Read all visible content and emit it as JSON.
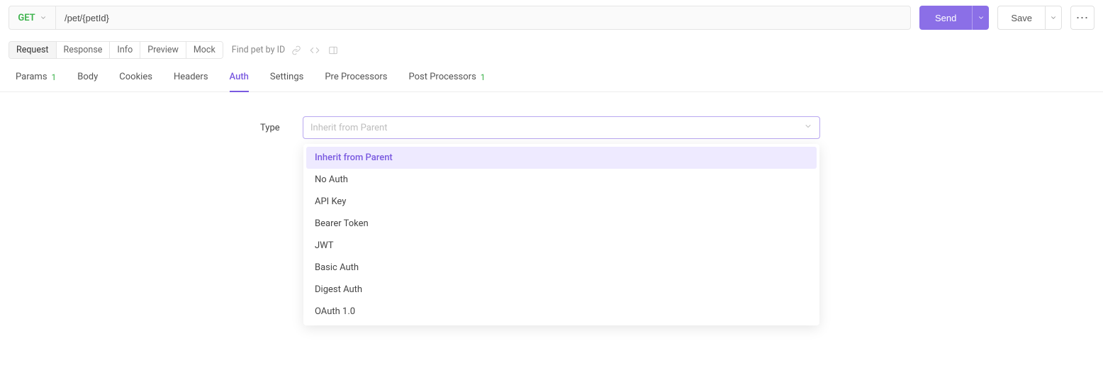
{
  "request": {
    "method": "GET",
    "url": "/pet/{petId}",
    "operation_name": "Find pet by ID"
  },
  "actions": {
    "send": "Send",
    "save": "Save"
  },
  "view_tabs": {
    "request": "Request",
    "response": "Response",
    "info": "Info",
    "preview": "Preview",
    "mock": "Mock",
    "active": "Request"
  },
  "config_tabs": {
    "items": [
      {
        "key": "params",
        "label": "Params",
        "count": "1"
      },
      {
        "key": "body",
        "label": "Body"
      },
      {
        "key": "cookies",
        "label": "Cookies"
      },
      {
        "key": "headers",
        "label": "Headers"
      },
      {
        "key": "auth",
        "label": "Auth"
      },
      {
        "key": "settings",
        "label": "Settings"
      },
      {
        "key": "pre",
        "label": "Pre Processors"
      },
      {
        "key": "post",
        "label": "Post Processors",
        "count": "1"
      }
    ],
    "active": "auth"
  },
  "auth": {
    "type_label": "Type",
    "select_placeholder": "Inherit from Parent",
    "selected": "Inherit from Parent",
    "options": [
      "Inherit from Parent",
      "No Auth",
      "API Key",
      "Bearer Token",
      "JWT",
      "Basic Auth",
      "Digest Auth",
      "OAuth 1.0"
    ]
  }
}
